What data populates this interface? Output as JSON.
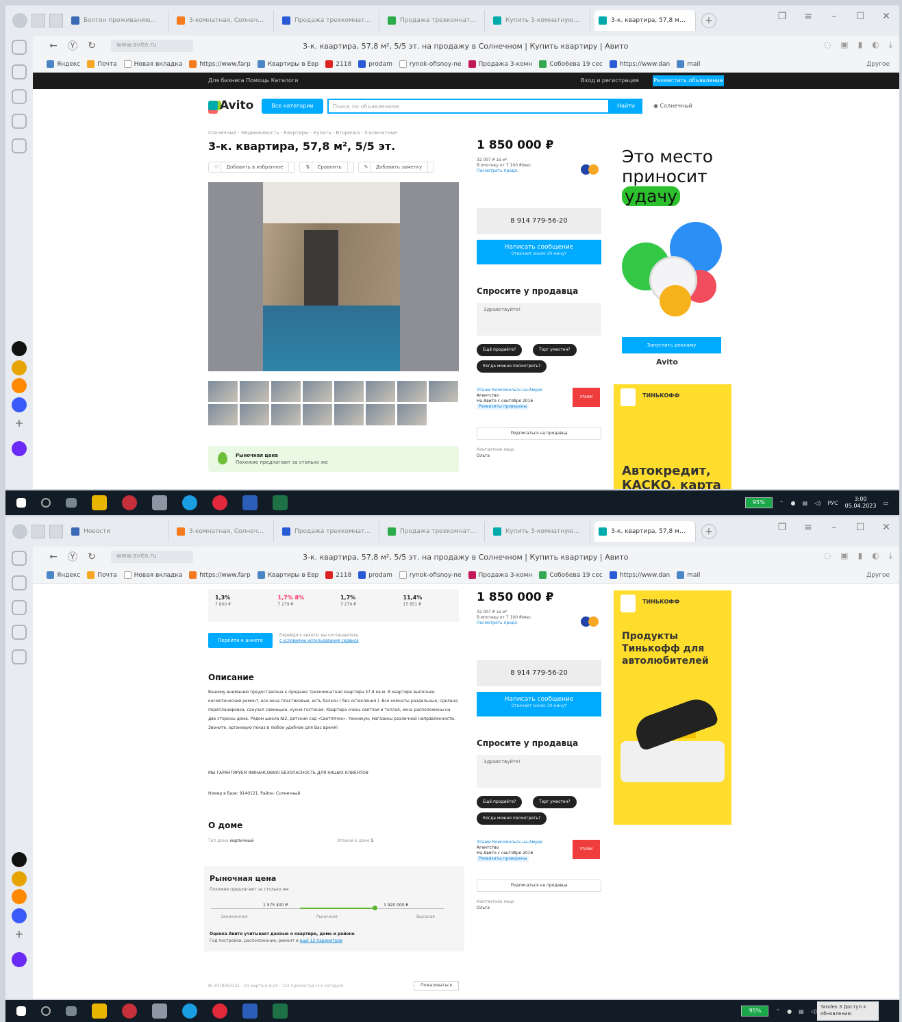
{
  "browser": {
    "tabs_top": [
      "Болгон проживанию…",
      "3-комнатная, Солнеч…",
      "Продажа трехкомнат…",
      "Продажа трехкомнат…",
      "Купить 3-комнатную…",
      "3-к. квартира, 57,8 м…"
    ],
    "tabs_bottom": [
      "Новости",
      "3-комнатная, Солнеч…",
      "Продажа трехкомнат…",
      "Продажа трехкомнат…",
      "Купить 3-комнатную…",
      "3-к. квартира, 57,8 м…"
    ],
    "host": "www.avito.ru",
    "page_title": "3-к. квартира, 57,8 м², 5/5 эт. на продажу в Солнечном | Купить квартиру | Авито",
    "bookmarks": [
      "Яндекс",
      "Почта",
      "Новая вкладка",
      "https://www.farp",
      "Квартиры в Евр",
      "2118",
      "prodam",
      "rynok-ofisnoy-ne",
      "Продажа 3-комн",
      "Собо6ева 19 сес",
      "https://www.dan",
      "mail"
    ],
    "bookmarks_more": "Другое"
  },
  "avito": {
    "topbar_left": "Для бизнеса   Помощь   Каталоги",
    "topbar_right": "Вход и регистрация",
    "topbar_button": "Разместить объявление",
    "logo": "Avito",
    "category_button": "Все категории",
    "search_placeholder": "Поиск по объявлениям",
    "search_button": "Найти",
    "city": "Солнечный",
    "breadcrumbs": "Солнечный · Недвижимость · Квартиры · Купить · Вторичка · 3-комнатные",
    "title": "3-к. квартира, 57,8 м², 5/5 эт.",
    "actions": [
      "Добавить в избранное",
      "Сравнить",
      "Добавить заметку"
    ],
    "market_box_title": "Рыночная цена",
    "market_box_sub": "Похожие предлагают за столько же",
    "price": "1 850 000 ₽",
    "price_per_m": "32 007 ₽ за м²",
    "mortgage": "В ипотеку от 7 100 ₽/мес.",
    "mortgage_link": "Посмотреть предл.",
    "phone": "8 914 779-56-20",
    "msg_button": "Написать сообщение",
    "msg_sub": "Отвечает около 30 минут",
    "ask_title": "Спросите у продавца",
    "ask_placeholder": "Здравствуйте!",
    "chips": [
      "Ещё продаёте?",
      "Торг уместен?",
      "Когда можно посмотреть?"
    ],
    "seller_name": "Этажи Комсомольск-на-Амуре",
    "seller_type": "Агентство",
    "seller_since": "На Авито с сентября 2016",
    "seller_badge": "Реквизиты проверены",
    "seller_logo": "ЭТАЖИ",
    "subscribe": "Подписаться на продавца",
    "response_label": "Контактное лицо",
    "response_value": "Ольга",
    "mini_stats": [
      {
        "pct": "1,3%",
        "sub": "7 800 ₽"
      },
      {
        "pct": "1,7% 8%",
        "sub": "7 279 ₽"
      },
      {
        "pct": "1,7%",
        "sub": "7 279 ₽"
      },
      {
        "pct": "11,4%",
        "sub": "15 851 ₽"
      }
    ],
    "card_button": "Перейти к анкете",
    "card_note_1": "Перейдя к анкете, вы соглашаетесь",
    "card_note_2": "с условиями использования сервиса",
    "desc_title": "Описание",
    "desc_text": "Вашему вниманию предоставлена к продаже трехкомнатная квартира 57.8 кв.м. В квартире выполнен косметический ремонт, все окна пластиковые, есть балкон ( без остекления ). Все комнаты раздельные, сделана перепланировка, санузел совмещен, кухня-гостиная. Квартира очень светлая и теплая, окна расположены на две стороны дома. Рядом школа №2, детский сад «Светлячок», техникум, магазины различной направленности. Звоните, организую показ в любое удобное для Вас время!",
    "desc_caps": "МЫ ГАРАНТИРУЕМ ФИНАНСОВУЮ БЕЗОПАСНОСТЬ ДЛЯ НАШИХ КЛИЕНТОВ",
    "desc_id": "Номер в базе: 9140121. Район: Солнечный",
    "house_title": "О доме",
    "house_type_label": "Тип дома",
    "house_type_value": "кирпичный",
    "house_floors_label": "Этажей в доме",
    "house_floors_value": "5",
    "market_title": "Рыночная цена",
    "market_sub": "Похожие предлагают за столько же",
    "market_tick_low": "1 575 400 ₽",
    "market_tick_high": "1 920 000 ₽",
    "market_labels": [
      "Заниженная",
      "Рыночная",
      "Высокая"
    ],
    "market_foot": "Оценка Авито учитывает данные о квартире, доме и районе",
    "market_foot2": "Год постройки, расположение, ремонт и",
    "market_foot2_link": "ещё 12 параметров",
    "footer_line": "№ 2978263221 · 24 марта в 9:24 · 132 просмотра (+5 сегодня)",
    "footer_button": "Пожаловаться"
  },
  "ads": {
    "ad1_line1": "Это место",
    "ad1_line2": "приносит",
    "ad1_line3": "удачу",
    "ad1_button": "Запустить рекламу",
    "ad1_logo": "Avito",
    "tinkoff": "ТИНЬКОФФ",
    "ad2_headline": "Автокредит, КАСКО, карта",
    "ad3_headline": "Продукты Тинькофф для автолюбителей"
  },
  "taskbar": {
    "battery": "95%",
    "lang": "РУС",
    "time": "3:00",
    "date": "05.04.2023",
    "toast": "Yandex 3 Доступ к обновлению"
  },
  "colors": {
    "avito_blue": "#00aaff",
    "tinkoff_yellow": "#ffdd2d",
    "taskbar": "#111c26"
  }
}
